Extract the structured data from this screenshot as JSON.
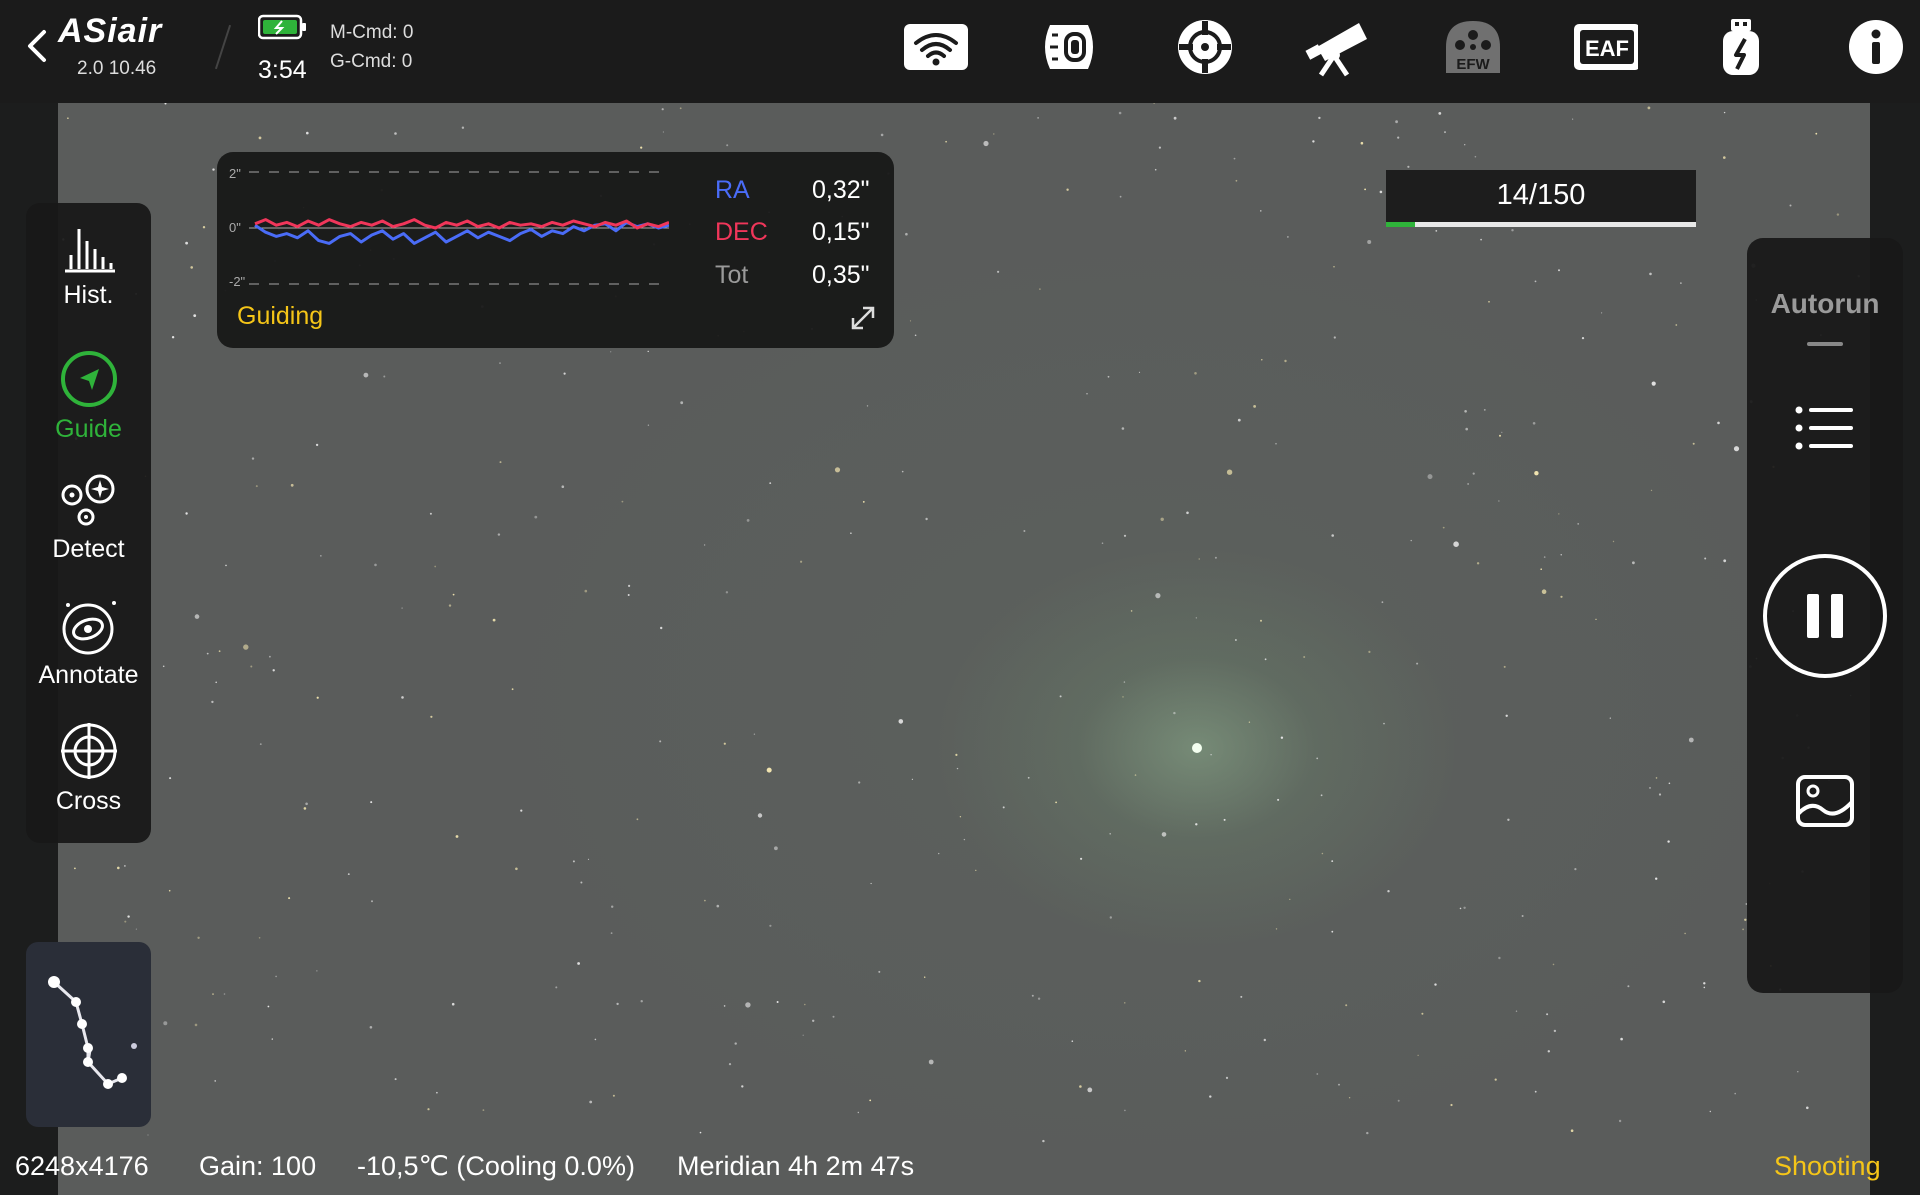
{
  "app": {
    "brand": "ASiair",
    "version": "2.0 10.46",
    "clock": "3:54",
    "m_cmd": "M-Cmd: 0",
    "g_cmd": "G-Cmd: 0"
  },
  "top_icons": [
    "wifi-icon",
    "camera-icon",
    "guide-target-icon",
    "telescope-icon",
    "efw-icon",
    "eaf-icon",
    "usb-power-icon",
    "info-icon"
  ],
  "top_icon_labels": {
    "efw": "EFW",
    "eaf": "EAF"
  },
  "tools": [
    {
      "name": "hist",
      "label": "Hist.",
      "active": false
    },
    {
      "name": "guide",
      "label": "Guide",
      "active": true
    },
    {
      "name": "detect",
      "label": "Detect",
      "active": false
    },
    {
      "name": "annotate",
      "label": "Annotate",
      "active": false
    },
    {
      "name": "cross",
      "label": "Cross",
      "active": false
    }
  ],
  "guiding": {
    "axis_top": "2\"",
    "axis_mid": "0\"",
    "axis_bottom": "-2\"",
    "ra_label": "RA",
    "ra_value": "0,32\"",
    "dec_label": "DEC",
    "dec_value": "0,15\"",
    "tot_label": "Tot",
    "tot_value": "0,35\"",
    "status": "Guiding",
    "ra_color": "#4a6cf7",
    "dec_color": "#f0365a",
    "ra_trace": [
      0.1,
      -0.15,
      -0.3,
      -0.2,
      -0.35,
      -0.1,
      -0.45,
      -0.55,
      -0.3,
      -0.2,
      -0.5,
      -0.25,
      -0.1,
      -0.4,
      -0.2,
      -0.55,
      -0.35,
      -0.15,
      -0.5,
      -0.3,
      -0.1,
      -0.35,
      -0.15,
      -0.3,
      -0.45,
      -0.2,
      -0.05,
      -0.3,
      -0.1,
      -0.2,
      0.05,
      -0.1,
      0.1,
      0.15,
      -0.1,
      0.2,
      0.05,
      0.15,
      0.0,
      0.1
    ],
    "dec_trace": [
      0.15,
      0.3,
      0.1,
      0.2,
      0.05,
      0.25,
      0.1,
      0.3,
      0.15,
      0.05,
      0.2,
      0.1,
      0.25,
      0.05,
      0.15,
      0.3,
      0.1,
      0.0,
      0.2,
      0.1,
      0.25,
      0.05,
      0.15,
      0.0,
      0.2,
      0.1,
      0.15,
      0.05,
      0.2,
      0.1,
      0.25,
      0.15,
      0.05,
      0.2,
      0.1,
      0.25,
      0.0,
      0.15,
      0.05,
      0.2
    ]
  },
  "progress": {
    "text": "14/150",
    "current": 14,
    "total": 150
  },
  "right_panel": {
    "autorun": "Autorun"
  },
  "status": {
    "resolution": "6248x4176",
    "gain": "Gain: 100",
    "temperature": "-10,5℃ (Cooling 0.0%)",
    "meridian": "Meridian 4h 2m 47s",
    "state": "Shooting"
  },
  "colors": {
    "accent_green": "#2fb33a",
    "status_yellow": "#f5c518"
  }
}
